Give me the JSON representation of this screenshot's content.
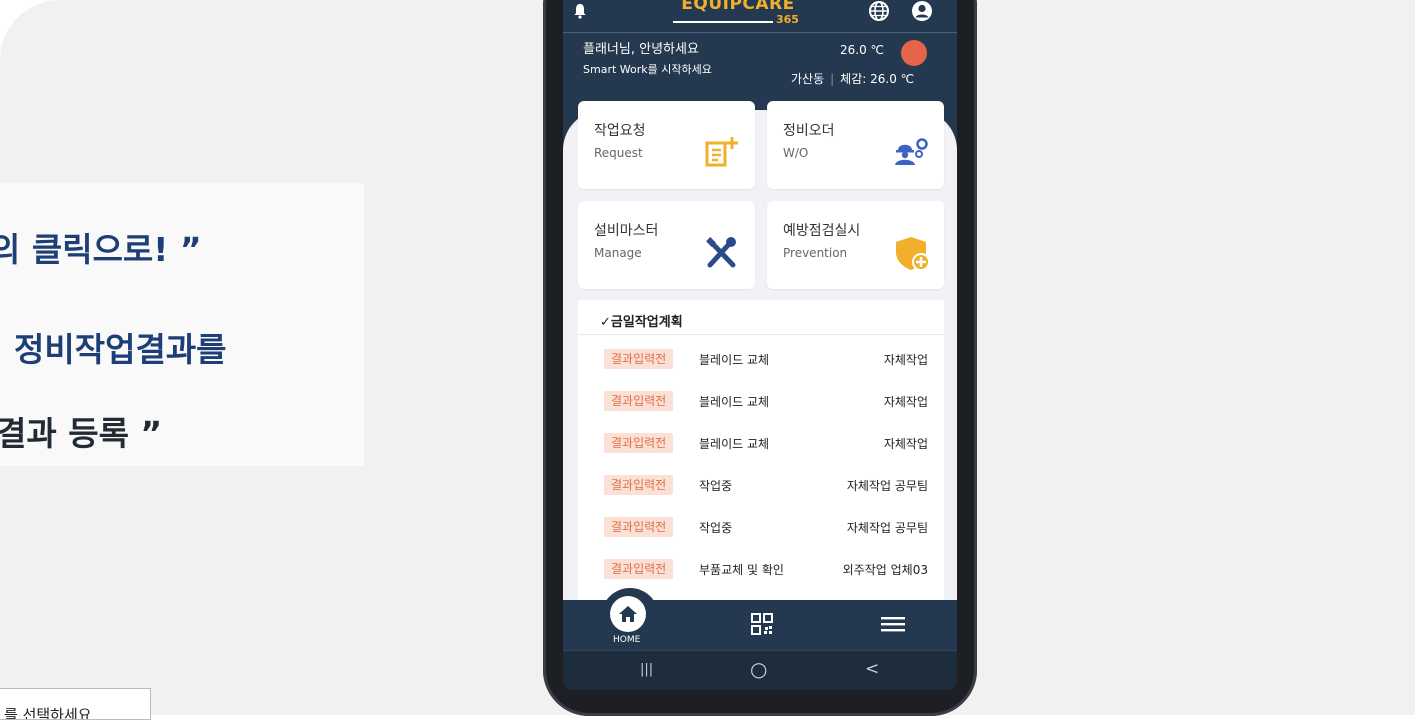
{
  "callout": {
    "line1": "의 클릭으로! ”",
    "line2": ", 정비작업결과를",
    "line3": "결과 등록 ”"
  },
  "small_box_text": "를 선택하세요",
  "app": {
    "logo_main": "EQUIPCARE",
    "logo_sub": "365",
    "greeting": "플래너님, 안녕하세요",
    "subgreeting": "Smart Work를 시작하세요",
    "temperature": "26.0 ℃",
    "location": "가산동",
    "feels_like": "체감: 26.0 ℃",
    "sun_color": "#e5654a"
  },
  "cards": [
    {
      "title": "작업요청",
      "subtitle": "Request",
      "icon": "document-add-icon"
    },
    {
      "title": "정비오더",
      "subtitle": "W/O",
      "icon": "worker-gear-icon"
    },
    {
      "title": "설비마스터",
      "subtitle": "Manage",
      "icon": "tools-icon"
    },
    {
      "title": "예방점검실시",
      "subtitle": "Prevention",
      "icon": "shield-plus-icon"
    }
  ],
  "plan": {
    "title": "✓금일작업계획",
    "rows": [
      {
        "status": "결과입력전",
        "task": "블레이드 교체",
        "assignee": "자체작업"
      },
      {
        "status": "결과입력전",
        "task": "블레이드 교체",
        "assignee": "자체작업"
      },
      {
        "status": "결과입력전",
        "task": "블레이드 교체",
        "assignee": "자체작업"
      },
      {
        "status": "결과입력전",
        "task": "작업중",
        "assignee": "자체작업 공무팀"
      },
      {
        "status": "결과입력전",
        "task": "작업중",
        "assignee": "자체작업 공무팀"
      },
      {
        "status": "결과입력전",
        "task": "부품교체 및 확인",
        "assignee": "외주작업 업체03"
      }
    ]
  },
  "bottom_nav": {
    "home_label": "HOME"
  },
  "system_nav": {
    "recent": "|||",
    "home": "○",
    "back": "<"
  },
  "colors": {
    "header_bg": "#24384f",
    "accent_orange": "#f0b02b",
    "badge_bg": "#fbe0d5",
    "badge_text": "#e0704a",
    "callout_text": "#1d3f76"
  }
}
